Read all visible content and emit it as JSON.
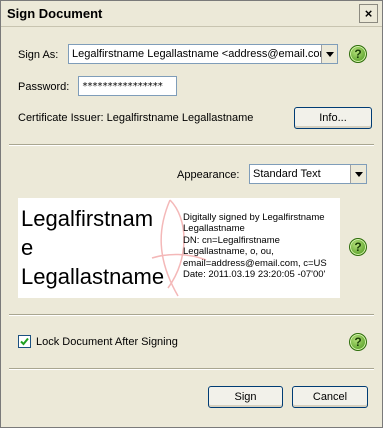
{
  "window": {
    "title": "Sign Document",
    "close_glyph": "×"
  },
  "sign_as": {
    "label": "Sign As:",
    "value": "Legalfirstname Legallastname <address@email.com"
  },
  "password": {
    "label": "Password:",
    "value": "****************"
  },
  "certificate_issuer": {
    "text": "Certificate Issuer: Legalfirstname Legallastname",
    "info_button": "Info..."
  },
  "appearance": {
    "label": "Appearance:",
    "value": "Standard Text"
  },
  "signature_preview": {
    "name_line1": "Legalfirstnam",
    "name_line2": "e",
    "name_line3": "Legallastname",
    "details": [
      "Digitally signed by Legalfirstname",
      "Legallastname",
      "DN: cn=Legalfirstname",
      "Legallastname, o, ou,",
      "email=address@email.com, c=US",
      "Date: 2011.03.19 23:20:05 -07'00'"
    ]
  },
  "lock_document": {
    "label": "Lock Document After Signing",
    "checked": true
  },
  "buttons": {
    "sign": "Sign",
    "cancel": "Cancel"
  },
  "help_glyph": "?"
}
